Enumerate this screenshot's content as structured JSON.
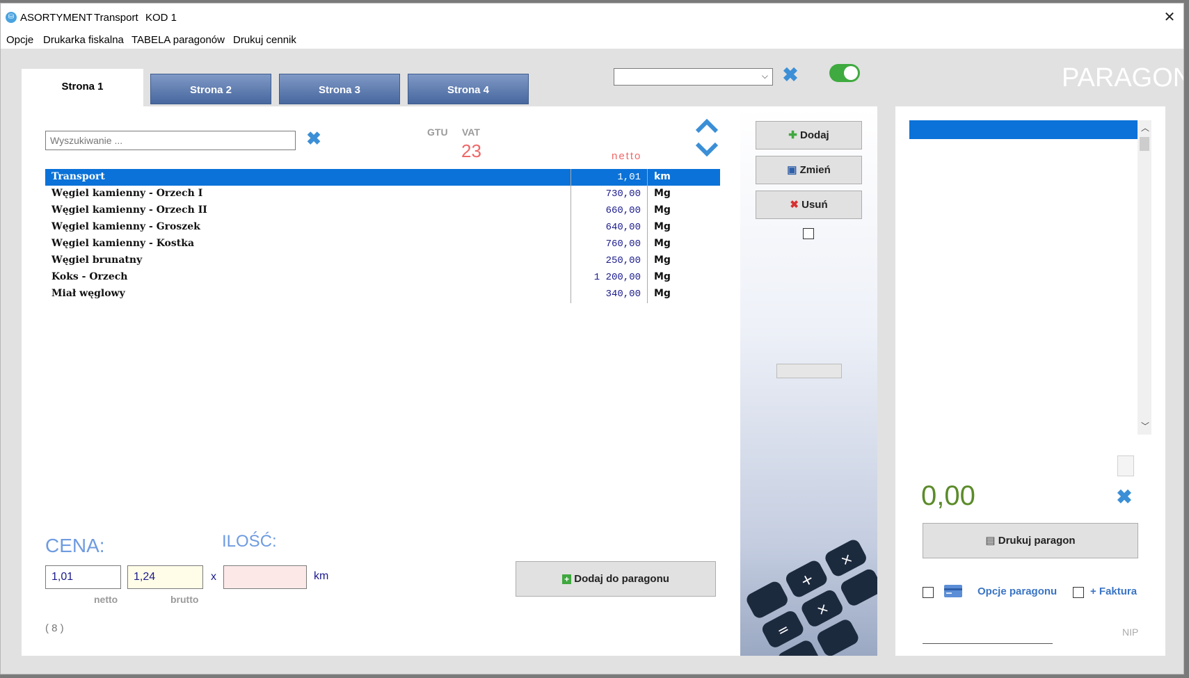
{
  "titlebar": {
    "app": "ASORTYMENT",
    "group": "Transport",
    "code": "KOD 1",
    "close": "✕"
  },
  "menu": [
    "Opcje",
    "Drukarka fiskalna",
    "TABELA paragonów",
    "Drukuj cennik"
  ],
  "tabs": [
    "Strona 1",
    "Strona 2",
    "Strona 3",
    "Strona 4"
  ],
  "toggle_on": true,
  "paragon_title": "PARAGON",
  "search": {
    "placeholder": "Wyszukiwanie ..."
  },
  "headers": {
    "gtu": "GTU",
    "vat": "VAT",
    "vat_value": "23",
    "netto": "netto"
  },
  "products": [
    {
      "name": "Transport",
      "price": "1,01",
      "unit": "km",
      "selected": true
    },
    {
      "name": "Węgiel kamienny - Orzech I",
      "price": "730,00",
      "unit": "Mg"
    },
    {
      "name": "Węgiel kamienny - Orzech II",
      "price": "660,00",
      "unit": "Mg"
    },
    {
      "name": "Węgiel kamienny - Groszek",
      "price": "640,00",
      "unit": "Mg"
    },
    {
      "name": "Węgiel kamienny - Kostka",
      "price": "760,00",
      "unit": "Mg"
    },
    {
      "name": "Węgiel brunatny",
      "price": "250,00",
      "unit": "Mg"
    },
    {
      "name": "Koks - Orzech",
      "price": "1 200,00",
      "unit": "Mg"
    },
    {
      "name": "Miał węglowy",
      "price": "340,00",
      "unit": "Mg"
    }
  ],
  "side_buttons": {
    "add": "Dodaj",
    "change": "Zmień",
    "delete": "Usuń"
  },
  "price_section": {
    "cena_label": "CENA:",
    "ilosc_label": "ILOŚĆ:",
    "netto_value": "1,01",
    "brutto_value": "1,24",
    "netto_label": "netto",
    "brutto_label": "brutto",
    "times": "x",
    "unit": "km",
    "add_to_receipt": "Dodaj do paragonu",
    "count": "( 8 )"
  },
  "receipt": {
    "total": "0,00",
    "print_button": "Drukuj paragon",
    "options_link": "Opcje paragonu",
    "invoice_link": "+ Faktura",
    "nip_label": "NIP"
  },
  "colors": {
    "selection": "#0a72d8",
    "accent_blue": "#3b8fd6",
    "total_green": "#5b8b2a",
    "vat_red": "#f06666"
  }
}
